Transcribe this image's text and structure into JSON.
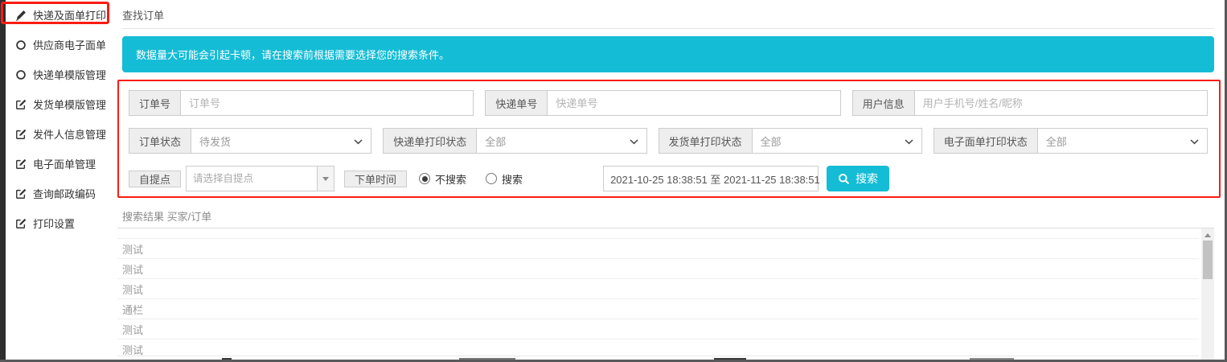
{
  "colors": {
    "accent": "#15bcd5",
    "alert_border": "#fa1c13",
    "rail": "#2e2e2e"
  },
  "sidebar": {
    "items": [
      {
        "label": "快递及面单打印",
        "icon": "pen-icon",
        "active": true
      },
      {
        "label": "供应商电子面单",
        "icon": "circle-icon",
        "active": false
      },
      {
        "label": "快递单模版管理",
        "icon": "circle-icon",
        "active": false
      },
      {
        "label": "发货单模版管理",
        "icon": "edit-icon",
        "active": false
      },
      {
        "label": "发件人信息管理",
        "icon": "edit-icon",
        "active": false
      },
      {
        "label": "电子面单管理",
        "icon": "edit-icon",
        "active": false
      },
      {
        "label": "查询邮政编码",
        "icon": "edit-icon",
        "active": false
      },
      {
        "label": "打印设置",
        "icon": "edit-icon",
        "active": false
      }
    ]
  },
  "header": {
    "tab_title": "查找订单"
  },
  "notice": {
    "text": "数据量大可能会引起卡顿，请在搜索前根据需要选择您的搜索条件。"
  },
  "search_form": {
    "row1": [
      {
        "label": "订单号",
        "placeholder": "订单号"
      },
      {
        "label": "快递单号",
        "placeholder": "快递单号"
      },
      {
        "label": "用户信息",
        "placeholder": "用户手机号/姓名/昵称"
      }
    ],
    "row2": [
      {
        "label": "订单状态",
        "value": "待发货"
      },
      {
        "label": "快递单打印状态",
        "value": "全部"
      },
      {
        "label": "发货单打印状态",
        "value": "全部"
      },
      {
        "label": "电子面单打印状态",
        "value": "全部"
      }
    ],
    "row3": {
      "pickup_label": "自提点",
      "pickup_placeholder": "请选择自提点",
      "time_label": "下单时间",
      "radio_no_search": "不搜索",
      "radio_search": "搜索",
      "no_search_selected": true,
      "date_range": "2021-10-25 18:38:51 至 2021-11-25 18:38:51",
      "search_button_label": "搜索"
    }
  },
  "results": {
    "heading": "搜索结果 买家/订单",
    "rows": [
      "测试",
      "测试",
      "测试",
      "通栏",
      "测试",
      "测试"
    ]
  }
}
